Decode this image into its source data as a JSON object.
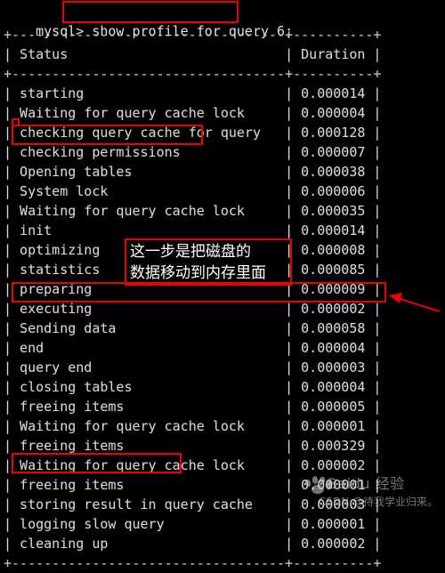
{
  "terminal": {
    "prompt": "mysql> ",
    "command": "show profile for query 6;",
    "separator": "+-----------------------------------+----------+",
    "header": {
      "status_label": "| Status                            | Duration |",
      "status_col": "Status",
      "duration_col": "Duration"
    },
    "rows": [
      {
        "status": "starting",
        "duration": "0.000014"
      },
      {
        "status": "Waiting for query cache lock",
        "duration": "0.000004"
      },
      {
        "status": "checking query cache for query",
        "duration": "0.000128"
      },
      {
        "status": "checking permissions",
        "duration": "0.000007"
      },
      {
        "status": "Opening tables",
        "duration": "0.000038"
      },
      {
        "status": "System lock",
        "duration": "0.000006"
      },
      {
        "status": "Waiting for query cache lock",
        "duration": "0.000035"
      },
      {
        "status": "init",
        "duration": "0.000014"
      },
      {
        "status": "optimizing",
        "duration": "0.000008"
      },
      {
        "status": "statistics",
        "duration": "0.000085"
      },
      {
        "status": "preparing",
        "duration": "0.000009"
      },
      {
        "status": "executing",
        "duration": "0.000002"
      },
      {
        "status": "Sending data",
        "duration": "0.000058"
      },
      {
        "status": "end",
        "duration": "0.000004"
      },
      {
        "status": "query end",
        "duration": "0.000003"
      },
      {
        "status": "closing tables",
        "duration": "0.000004"
      },
      {
        "status": "freeing items",
        "duration": "0.000005"
      },
      {
        "status": "Waiting for query cache lock",
        "duration": "0.000001"
      },
      {
        "status": "freeing items",
        "duration": "0.000329"
      },
      {
        "status": "Waiting for query cache lock",
        "duration": "0.000002"
      },
      {
        "status": "freeing items",
        "duration": "0.000001"
      },
      {
        "status": "storing result in query cache",
        "duration": "0.000003"
      },
      {
        "status": "logging slow query",
        "duration": "0.000001"
      },
      {
        "status": "cleaning up",
        "duration": "0.000002"
      }
    ]
  },
  "annotations": {
    "accent_color": "#ee0000",
    "note_text": "这一步是把磁盘的\n数据移动到内存里面",
    "highlight_command": "show profile for query 6;",
    "highlight_permissions": "checking permissions",
    "highlight_sending_data": "Sending data",
    "highlight_slow_query": "logging slow query"
  },
  "watermark": {
    "baidu": "Baidu 经验",
    "csdn": "CSDN @待我学业归来。"
  }
}
